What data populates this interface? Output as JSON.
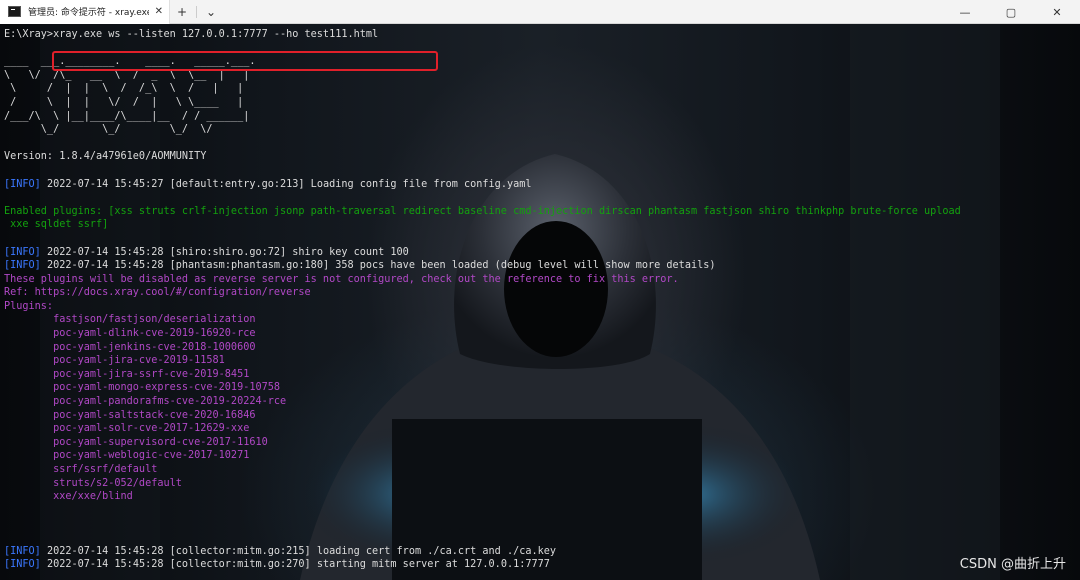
{
  "window": {
    "tab_title": "管理员: 命令提示符 - xray.exe",
    "tab_close": "✕",
    "new_tab": "+",
    "dropdown": "⌄",
    "minimize": "—",
    "maximize": "▢",
    "close": "✕"
  },
  "terminal": {
    "lines": [
      {
        "color": "w",
        "text": "E:\\Xray>xray.exe ws --listen 127.0.0.1:7777 --ho test111.html"
      },
      {
        "color": "w",
        "text": ""
      },
      {
        "color": "w",
        "text": "____  ___.________.    ____.   _____.___."
      },
      {
        "color": "w",
        "text": "\\   \\/  /\\_   __  \\  /  _  \\  \\__  |   |"
      },
      {
        "color": "w",
        "text": " \\     /  |  |  \\  /  /_\\  \\  /   |   |"
      },
      {
        "color": "w",
        "text": " /     \\  |  |   \\/  /  |   \\ \\____   |"
      },
      {
        "color": "w",
        "text": "/___/\\  \\ |__|____/\\____|__  / / ______|"
      },
      {
        "color": "w",
        "text": "      \\_/       \\_/        \\_/  \\/"
      },
      {
        "color": "w",
        "text": ""
      },
      {
        "color": "w",
        "text": "Version: 1.8.4/a47961e0/AOMMUNITY"
      },
      {
        "color": "w",
        "text": ""
      },
      {
        "color": "info",
        "tag": "[INFO]",
        "text": " 2022-07-14 15:45:27 [default:entry.go:213] Loading config file from config.yaml"
      },
      {
        "color": "w",
        "text": ""
      },
      {
        "color": "g",
        "text": "Enabled plugins: [xss struts crlf-injection jsonp path-traversal redirect baseline cmd-injection dirscan phantasm fastjson shiro thinkphp brute-force upload"
      },
      {
        "color": "g",
        "text": " xxe sqldet ssrf]"
      },
      {
        "color": "w",
        "text": ""
      },
      {
        "color": "info",
        "tag": "[INFO]",
        "text": " 2022-07-14 15:45:28 [shiro:shiro.go:72] shiro key count 100"
      },
      {
        "color": "info",
        "tag": "[INFO]",
        "text": " 2022-07-14 15:45:28 [phantasm:phantasm.go:180] 358 pocs have been loaded (debug level will show more details)"
      },
      {
        "color": "m",
        "text": "These plugins will be disabled as reverse server is not configured, check out the reference to fix this error."
      },
      {
        "color": "m",
        "text": "Ref: https://docs.xray.cool/#/configration/reverse"
      },
      {
        "color": "m",
        "text": "Plugins:"
      },
      {
        "color": "m",
        "text": "        fastjson/fastjson/deserialization"
      },
      {
        "color": "m",
        "text": "        poc-yaml-dlink-cve-2019-16920-rce"
      },
      {
        "color": "m",
        "text": "        poc-yaml-jenkins-cve-2018-1000600"
      },
      {
        "color": "m",
        "text": "        poc-yaml-jira-cve-2019-11581"
      },
      {
        "color": "m",
        "text": "        poc-yaml-jira-ssrf-cve-2019-8451"
      },
      {
        "color": "m",
        "text": "        poc-yaml-mongo-express-cve-2019-10758"
      },
      {
        "color": "m",
        "text": "        poc-yaml-pandorafms-cve-2019-20224-rce"
      },
      {
        "color": "m",
        "text": "        poc-yaml-saltstack-cve-2020-16846"
      },
      {
        "color": "m",
        "text": "        poc-yaml-solr-cve-2017-12629-xxe"
      },
      {
        "color": "m",
        "text": "        poc-yaml-supervisord-cve-2017-11610"
      },
      {
        "color": "m",
        "text": "        poc-yaml-weblogic-cve-2017-10271"
      },
      {
        "color": "m",
        "text": "        ssrf/ssrf/default"
      },
      {
        "color": "m",
        "text": "        struts/s2-052/default"
      },
      {
        "color": "m",
        "text": "        xxe/xxe/blind"
      },
      {
        "color": "w",
        "text": ""
      },
      {
        "color": "w",
        "text": ""
      },
      {
        "color": "w",
        "text": ""
      },
      {
        "color": "info",
        "tag": "[INFO]",
        "text": " 2022-07-14 15:45:28 [collector:mitm.go:215] loading cert from ./ca.crt and ./ca.key"
      },
      {
        "color": "info",
        "tag": "[INFO]",
        "text": " 2022-07-14 15:45:28 [collector:mitm.go:270] starting mitm server at 127.0.0.1:7777"
      }
    ]
  },
  "watermark": "CSDN @曲折上升",
  "colors": {
    "text": "#dcdcdc",
    "info": "#3b78ff",
    "green": "#13a10e",
    "magenta": "#b148c6",
    "highlight": "#e0202a"
  }
}
